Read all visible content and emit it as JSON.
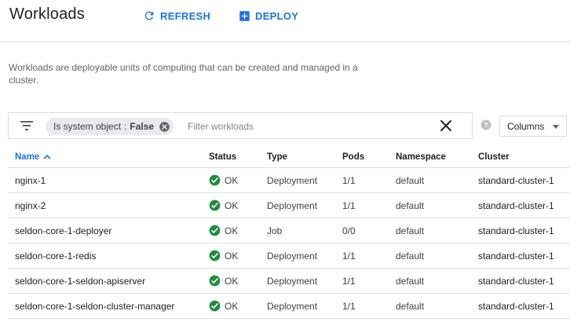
{
  "header": {
    "title": "Workloads",
    "refresh_label": "REFRESH",
    "deploy_label": "DEPLOY"
  },
  "description": "Workloads are deployable units of computing that can be created and managed in a cluster.",
  "filter": {
    "chip_key": "Is system object",
    "chip_separator": ":",
    "chip_value": "False",
    "placeholder": "Filter workloads"
  },
  "columns_button": "Columns",
  "table": {
    "headers": {
      "name": "Name",
      "status": "Status",
      "type": "Type",
      "pods": "Pods",
      "namespace": "Namespace",
      "cluster": "Cluster"
    },
    "sort": "ascending",
    "rows": [
      {
        "name": "nginx-1",
        "status": "OK",
        "type": "Deployment",
        "pods": "1/1",
        "namespace": "default",
        "cluster": "standard-cluster-1"
      },
      {
        "name": "nginx-2",
        "status": "OK",
        "type": "Deployment",
        "pods": "1/1",
        "namespace": "default",
        "cluster": "standard-cluster-1"
      },
      {
        "name": "seldon-core-1-deployer",
        "status": "OK",
        "type": "Job",
        "pods": "0/0",
        "namespace": "default",
        "cluster": "standard-cluster-1"
      },
      {
        "name": "seldon-core-1-redis",
        "status": "OK",
        "type": "Deployment",
        "pods": "1/1",
        "namespace": "default",
        "cluster": "standard-cluster-1"
      },
      {
        "name": "seldon-core-1-seldon-apiserver",
        "status": "OK",
        "type": "Deployment",
        "pods": "1/1",
        "namespace": "default",
        "cluster": "standard-cluster-1"
      },
      {
        "name": "seldon-core-1-seldon-cluster-manager",
        "status": "OK",
        "type": "Deployment",
        "pods": "1/1",
        "namespace": "default",
        "cluster": "standard-cluster-1"
      }
    ]
  },
  "icons": {
    "refresh": "refresh-icon",
    "deploy": "add-box-icon",
    "filter": "filter-list-icon",
    "chip_remove": "cancel-circle-icon",
    "clear": "close-icon",
    "help": "help-icon",
    "status_ok": "check-circle-icon",
    "sort": "arrow-up-icon"
  },
  "colors": {
    "accent": "#1a73e8",
    "ok_green": "#1e8e3e",
    "text": "#3c4043",
    "muted": "#5f6368"
  }
}
